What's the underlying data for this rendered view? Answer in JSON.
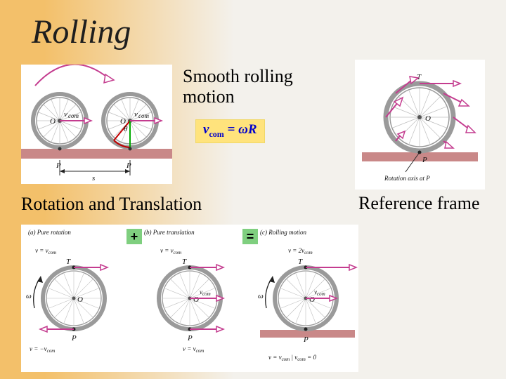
{
  "title": "Rolling",
  "smooth_label": "Smooth rolling\nmotion",
  "rotation_label": "Rotation and Translation",
  "reference_label": "Reference frame",
  "equation": {
    "lhs_v": "v",
    "lhs_sub": "com",
    "equals": " = ",
    "omega": "ω",
    "R": "R"
  },
  "fig_top_left": {
    "O": "O",
    "P": "P",
    "s": "s",
    "theta": "θ",
    "vcom": "v",
    "vcom_sub": "com"
  },
  "fig_top_right": {
    "T": "T",
    "O": "O",
    "P": "P",
    "axis_label": "Rotation axis at P"
  },
  "bottom": {
    "a_caption": "(a)   Pure rotation",
    "b_caption": "(b)   Pure translation",
    "c_caption": "(c)   Rolling motion",
    "plus": "+",
    "eq": "=",
    "T": "T",
    "O": "O",
    "P": "P",
    "omega": "ω",
    "v": "v",
    "vcom_sub": "com",
    "a_top": "v = v",
    "a_bot": "v = −v",
    "b_all": "v = v",
    "c_top": "v = 2v",
    "c_mid": "v = v",
    "c_bot_l": "v = v",
    "c_bot_r": " | v",
    "c_bot_eq": " = 0"
  }
}
